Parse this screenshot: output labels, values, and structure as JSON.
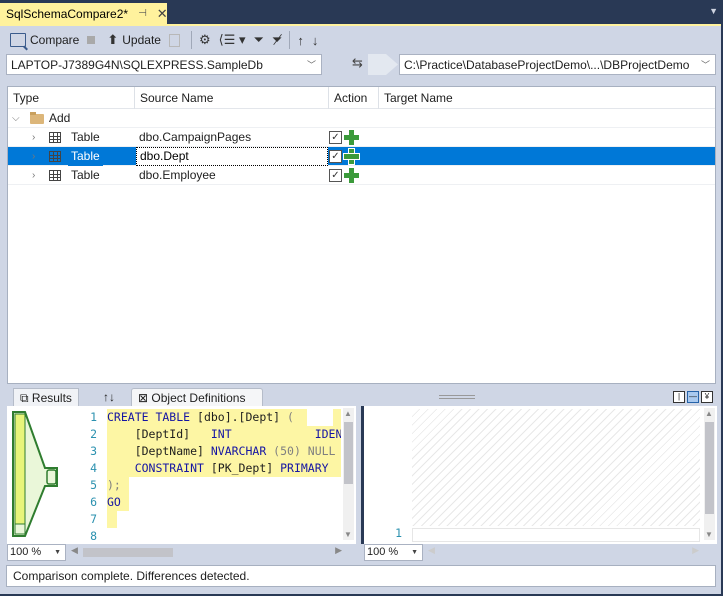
{
  "document_tab": {
    "title": "SqlSchemaCompare2*",
    "pin_icon": "pin-icon",
    "close_icon": "close-icon"
  },
  "toolbar": {
    "compare_label": "Compare",
    "update_label": "Update",
    "icons": [
      "compare-icon",
      "stop-icon",
      "update-icon",
      "generate-script-icon",
      "options-icon",
      "group-results-icon",
      "filter-icon",
      "clear-filter-icon",
      "next-change-icon",
      "previous-change-icon"
    ]
  },
  "source": {
    "value": "LAPTOP-J7389G4N\\SQLEXPRESS.SampleDb"
  },
  "target": {
    "value": "C:\\Practice\\DatabaseProjectDemo\\...\\DBProjectDemo"
  },
  "grid": {
    "columns": [
      "Type",
      "Source Name",
      "Action",
      "Target Name"
    ],
    "group": {
      "label": "Add",
      "expanded": true
    },
    "rows": [
      {
        "type": "Table",
        "source_name": "dbo.CampaignPages",
        "action_checked": true,
        "action": "add",
        "target_name": "",
        "selected": false
      },
      {
        "type": "Table",
        "source_name": "dbo.Dept",
        "action_checked": true,
        "action": "add",
        "target_name": "",
        "selected": true
      },
      {
        "type": "Table",
        "source_name": "dbo.Employee",
        "action_checked": true,
        "action": "add",
        "target_name": "",
        "selected": false
      }
    ]
  },
  "bottom_tabs": {
    "results_label": "Results",
    "sort_label": "↑↓",
    "object_definitions_label": "Object Definitions",
    "active": "Object Definitions"
  },
  "source_definition": {
    "line_numbers": [
      "1",
      "2",
      "3",
      "4",
      "5",
      "6",
      "7",
      "8"
    ],
    "lines": [
      [
        {
          "t": "CREATE TABLE ",
          "c": "kw"
        },
        {
          "t": "[dbo].[Dept] ",
          "c": "plain"
        },
        {
          "t": "(",
          "c": "gr"
        }
      ],
      [
        {
          "t": "    [DeptId]   ",
          "c": "plain"
        },
        {
          "t": "INT            IDEN",
          "c": "kw"
        }
      ],
      [
        {
          "t": "    [DeptName] ",
          "c": "plain"
        },
        {
          "t": "NVARCHAR ",
          "c": "kw"
        },
        {
          "t": "(50) NULL",
          "c": "gr"
        }
      ],
      [
        {
          "t": "    CONSTRAINT ",
          "c": "kw"
        },
        {
          "t": "[PK_Dept] ",
          "c": "plain"
        },
        {
          "t": "PRIMARY",
          "c": "kw"
        }
      ],
      [
        {
          "t": ");",
          "c": "gr"
        }
      ],
      [
        {
          "t": "GO",
          "c": "kw"
        }
      ],
      [
        {
          "t": "",
          "c": "plain"
        }
      ],
      [
        {
          "t": "",
          "c": "plain"
        }
      ]
    ],
    "zoom": "100 %"
  },
  "target_definition": {
    "line_numbers": [
      "1"
    ],
    "zoom": "100 %"
  },
  "status": {
    "message": "Comparison complete.  Differences detected."
  },
  "colors": {
    "selection": "#0078d7",
    "add_icon": "#3b9a3b",
    "diff_highlight": "#fdf6a4",
    "tab_active": "#fff29d",
    "frame_bg": "#293955"
  }
}
